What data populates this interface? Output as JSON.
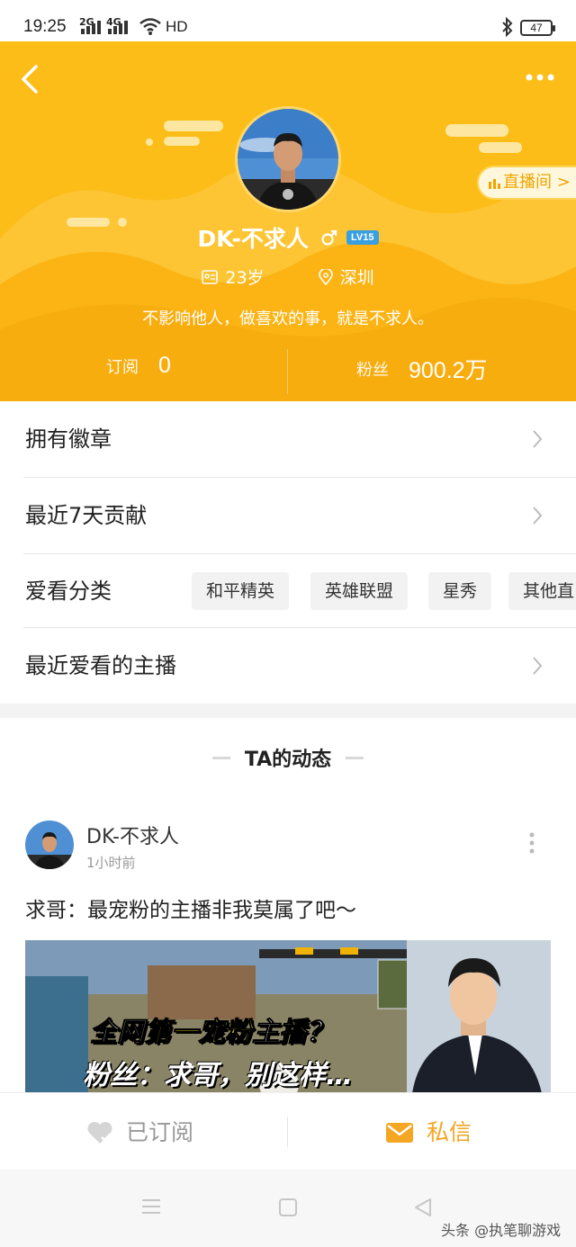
{
  "status_bar": {
    "time": "19:25",
    "signal1": "2G",
    "signal2": "4G",
    "network": "HD",
    "battery": "47"
  },
  "profile": {
    "name": "DK-不求人",
    "level": "LV15",
    "age": "23岁",
    "location": "深圳",
    "bio": "不影响他人，做喜欢的事，就是不求人。",
    "live_button": "直播间 >",
    "subscribe_label": "订阅",
    "subscribe_count": "0",
    "fans_label": "粉丝",
    "fans_count": "900.2万"
  },
  "menu": {
    "badges": "拥有徽章",
    "contribution": "最近7天贡献",
    "categories_label": "爱看分类",
    "categories": [
      "和平精英",
      "英雄联盟",
      "星秀",
      "其他直"
    ],
    "recent_anchors": "最近爱看的主播"
  },
  "feed": {
    "section_title": "TA的动态",
    "post": {
      "author": "DK-不求人",
      "time": "1小时前",
      "text": "求哥：最宠粉的主播非我莫属了吧～",
      "thumb_line1_a": "全网",
      "thumb_line1_b": "第一宠粉",
      "thumb_line1_c": "主播？",
      "thumb_line2": "粉丝：求哥，别这样…"
    }
  },
  "actions": {
    "subscribed": "已订阅",
    "message": "私信"
  },
  "watermark": "头条 @执笔聊游戏",
  "colors": {
    "header_bg": "#fcbd19",
    "accent": "#f5a623",
    "level_badge": "#3a9fe0"
  }
}
